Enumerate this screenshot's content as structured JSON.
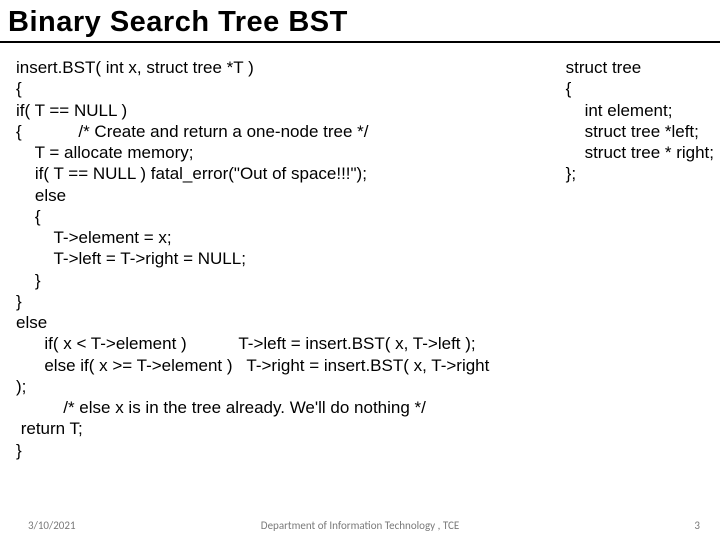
{
  "title": "Binary Search Tree BST",
  "code_left": "insert.BST( int x, struct tree *T )\n{\nif( T == NULL )\n{            /* Create and return a one-node tree */\n    T = allocate memory;\n    if( T == NULL ) fatal_error(\"Out of space!!!\");\n    else\n    {\n        T->element = x;\n        T->left = T->right = NULL;\n    }\n}\nelse\n      if( x < T->element )           T->left = insert.BST( x, T->left );\n      else if( x >= T->element )   T->right = insert.BST( x, T->right\n);\n          /* else x is in the tree already. We'll do nothing */\n return T;\n}",
  "struct_box": "struct tree\n{\n    int element;\n    struct tree *left;\n    struct tree * right;\n};",
  "footer": {
    "date": "3/10/2021",
    "center": "Department of Information Technology , TCE",
    "page": "3"
  }
}
